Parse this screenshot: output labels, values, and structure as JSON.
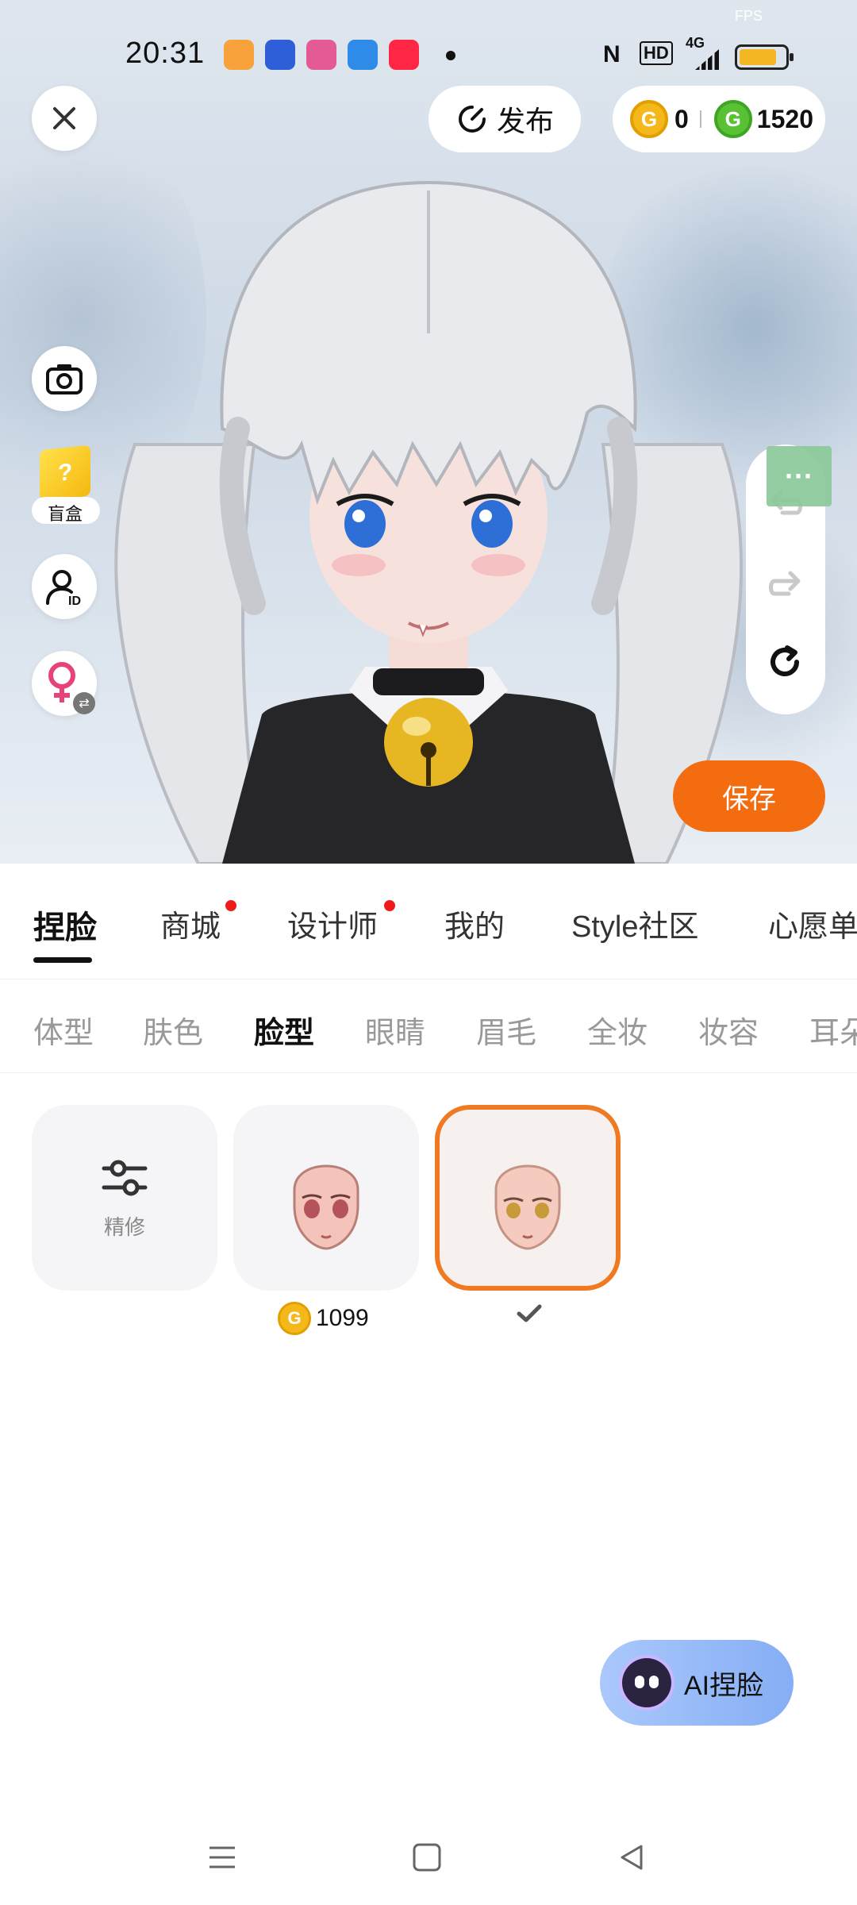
{
  "status_bar": {
    "time": "20:31",
    "fps_label": "FPS",
    "nfc": "N",
    "hd": "HD",
    "network": "4G"
  },
  "header": {
    "publish_label": "发布",
    "gold_coin_count": "0",
    "green_coin_count": "1520",
    "gold_coin_symbol": "G",
    "green_coin_symbol": "G"
  },
  "side_buttons": {
    "blind_box_label": "盲盒"
  },
  "save_label": "保存",
  "main_tabs": [
    {
      "label": "捏脸",
      "active": true,
      "dot": false
    },
    {
      "label": "商城",
      "active": false,
      "dot": true
    },
    {
      "label": "设计师",
      "active": false,
      "dot": true
    },
    {
      "label": "我的",
      "active": false,
      "dot": false
    },
    {
      "label": "Style社区",
      "active": false,
      "dot": false
    },
    {
      "label": "心愿单",
      "active": false,
      "dot": false
    }
  ],
  "sub_tabs": [
    {
      "label": "体型",
      "active": false
    },
    {
      "label": "肤色",
      "active": false
    },
    {
      "label": "脸型",
      "active": true
    },
    {
      "label": "眼睛",
      "active": false
    },
    {
      "label": "眉毛",
      "active": false
    },
    {
      "label": "全妆",
      "active": false
    },
    {
      "label": "妆容",
      "active": false
    },
    {
      "label": "耳朵",
      "active": false
    }
  ],
  "options": {
    "fine_tune_label": "精修",
    "item1_price": "1099",
    "item2_selected": true
  },
  "ai_button_label": "AI捏脸",
  "colors": {
    "accent_orange": "#f36c10",
    "selected_border": "#ef7a22",
    "red_dot": "#ee1b1b",
    "gold_coin": "#f5b81a",
    "green_coin": "#59c234"
  }
}
